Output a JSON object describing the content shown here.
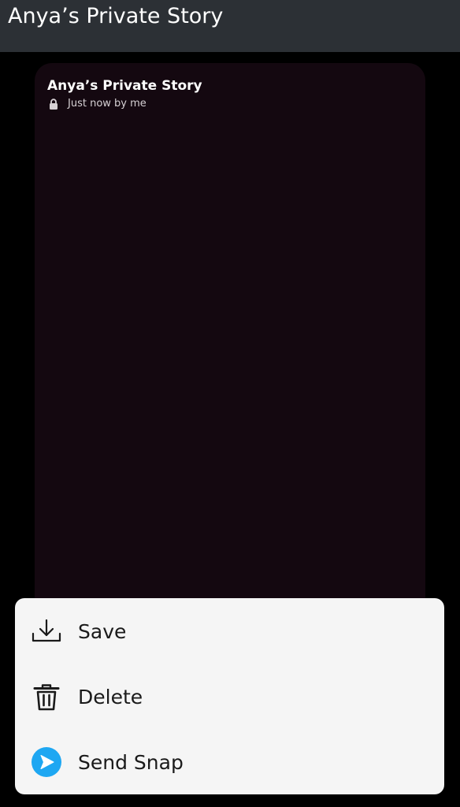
{
  "header": {
    "title": "Anya’s Private Story"
  },
  "story": {
    "title": "Anya’s Private Story",
    "subtitle": "Just now by me",
    "lock_icon": "lock-icon",
    "background_color": "#140810"
  },
  "menu": {
    "items": [
      {
        "label": "Save",
        "icon": "download-icon"
      },
      {
        "label": "Delete",
        "icon": "trash-icon"
      },
      {
        "label": "Send Snap",
        "icon": "send-icon",
        "icon_color": "#1ea7f2"
      }
    ]
  }
}
